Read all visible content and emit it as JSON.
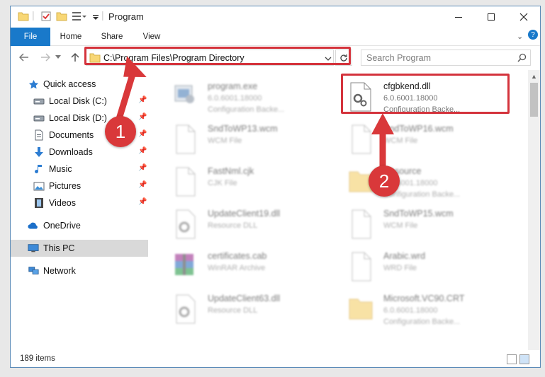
{
  "window": {
    "title": "Program"
  },
  "ribbon": {
    "tabs": [
      "File",
      "Home",
      "Share",
      "View"
    ]
  },
  "address": {
    "path": "C:\\Program Files\\Program Directory"
  },
  "search": {
    "placeholder": "Search Program"
  },
  "nav": {
    "items": [
      {
        "label": "Quick access",
        "icon": "star-icon",
        "pinned": false
      },
      {
        "label": "Local Disk (C:)",
        "icon": "drive-icon",
        "pinned": true
      },
      {
        "label": "Local Disk (D:)",
        "icon": "drive-icon",
        "pinned": true
      },
      {
        "label": "Documents",
        "icon": "documents-icon",
        "pinned": true
      },
      {
        "label": "Downloads",
        "icon": "download-arrow-icon",
        "pinned": true
      },
      {
        "label": "Music",
        "icon": "music-note-icon",
        "pinned": true
      },
      {
        "label": "Pictures",
        "icon": "pictures-icon",
        "pinned": true
      },
      {
        "label": "Videos",
        "icon": "film-icon",
        "pinned": true
      },
      {
        "label": "OneDrive",
        "icon": "cloud-icon",
        "pinned": false
      },
      {
        "label": "This PC",
        "icon": "monitor-icon",
        "pinned": false,
        "selected": true
      },
      {
        "label": "Network",
        "icon": "network-icon",
        "pinned": false
      }
    ]
  },
  "files": {
    "left": [
      {
        "name": "program.exe",
        "line1": "6.0.6001.18000",
        "line2": "Configuration Backe...",
        "icon": "exe-icon"
      },
      {
        "name": "SndToWP13.wcm",
        "line1": "WCM File",
        "line2": "",
        "icon": "blank-file-icon"
      },
      {
        "name": "FastNml.cjk",
        "line1": "CJK File",
        "line2": "",
        "icon": "blank-file-icon"
      },
      {
        "name": "UpdateClient19.dll",
        "line1": "Resource DLL",
        "line2": "",
        "icon": "dll-icon"
      },
      {
        "name": "certificates.cab",
        "line1": "WinRAR Archive",
        "line2": "",
        "icon": "winrar-icon"
      },
      {
        "name": "UpdateClient63.dll",
        "line1": "Resource DLL",
        "line2": "",
        "icon": "dll-icon"
      }
    ],
    "right": [
      {
        "name": "cfgbkend.dll",
        "line1": "6.0.6001.18000",
        "line2": "Configuration Backe...",
        "icon": "dll-gear-icon",
        "highlighted": true
      },
      {
        "name": "SndToWP16.wcm",
        "line1": "WCM File",
        "line2": "",
        "icon": "blank-file-icon"
      },
      {
        "name": "Resource",
        "line1": "6.0.6001.18000",
        "line2": "Configuration Backe...",
        "icon": "folder-icon"
      },
      {
        "name": "SndToWP15.wcm",
        "line1": "WCM File",
        "line2": "",
        "icon": "blank-file-icon"
      },
      {
        "name": "Arabic.wrd",
        "line1": "WRD File",
        "line2": "",
        "icon": "blank-file-icon"
      },
      {
        "name": "Microsoft.VC90.CRT",
        "line1": "6.0.6001.18000",
        "line2": "Configuration Backe...",
        "icon": "folder-icon"
      }
    ]
  },
  "status": {
    "items": "189 items"
  },
  "annotations": {
    "badge1": "1",
    "badge2": "2",
    "color": "#d4333c"
  }
}
